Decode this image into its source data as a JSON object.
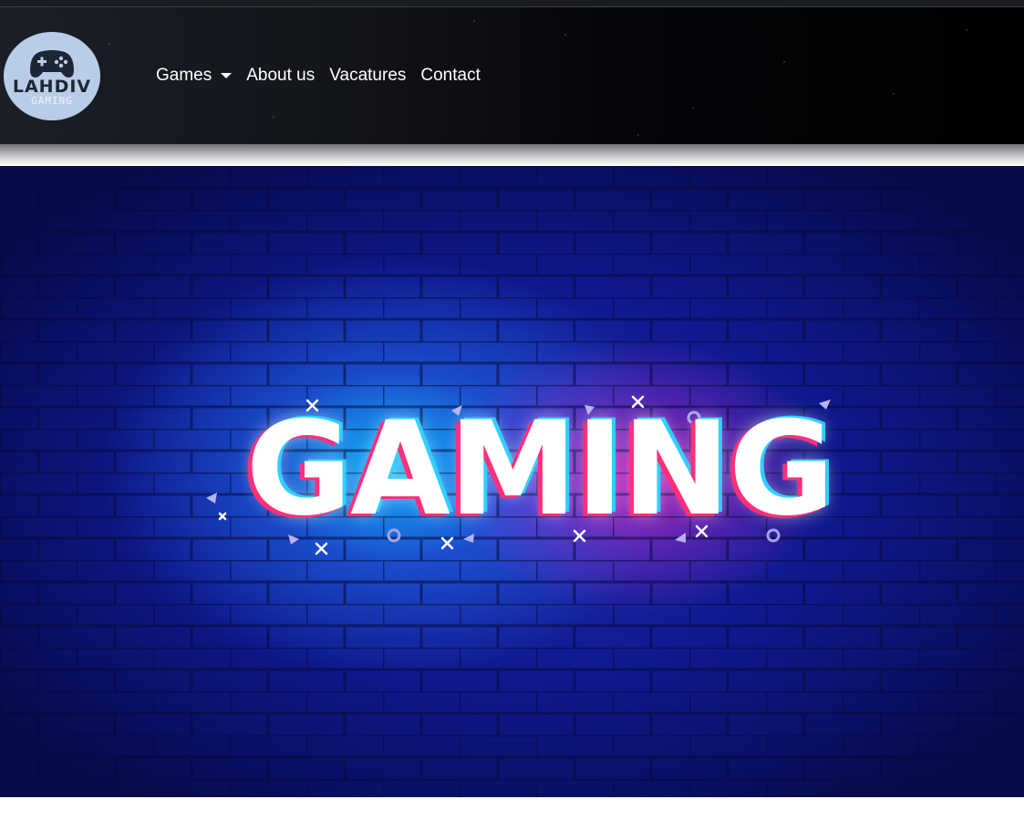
{
  "header": {
    "logo": {
      "title": "LAHDIV",
      "subtitle": "GAMING",
      "icon": "gamepad-icon",
      "background": "#b9cde8"
    },
    "nav": [
      {
        "label": "Games",
        "has_dropdown": true
      },
      {
        "label": "About us"
      },
      {
        "label": "Vacatures"
      },
      {
        "label": "Contact"
      }
    ]
  },
  "hero": {
    "headline": "GAMING",
    "colors": {
      "base": "#0f178a",
      "glow_cyan": "#14beff",
      "glow_magenta": "#e228be"
    }
  }
}
